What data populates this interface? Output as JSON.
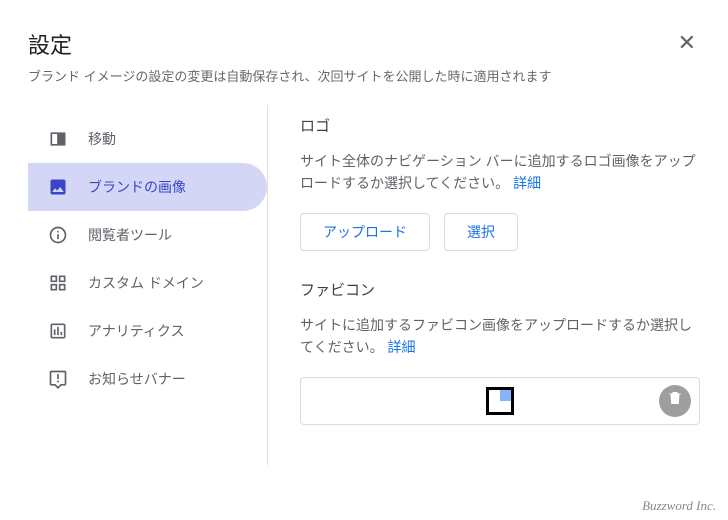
{
  "header": {
    "title": "設定",
    "subtitle": "ブランド イメージの設定の変更は自動保存され、次回サイトを公開した時に適用されます"
  },
  "sidebar": {
    "items": [
      {
        "label": "移動"
      },
      {
        "label": "ブランドの画像"
      },
      {
        "label": "閲覧者ツール"
      },
      {
        "label": "カスタム ドメイン"
      },
      {
        "label": "アナリティクス"
      },
      {
        "label": "お知らせバナー"
      }
    ]
  },
  "content": {
    "logo": {
      "title": "ロゴ",
      "desc": "サイト全体のナビゲーション バーに追加するロゴ画像をアップロードするか選択してください。",
      "details_label": "詳細",
      "upload_label": "アップロード",
      "select_label": "選択"
    },
    "favicon": {
      "title": "ファビコン",
      "desc": "サイトに追加するファビコン画像をアップロードするか選択してください。",
      "details_label": "詳細"
    }
  },
  "watermark": "Buzzword Inc."
}
